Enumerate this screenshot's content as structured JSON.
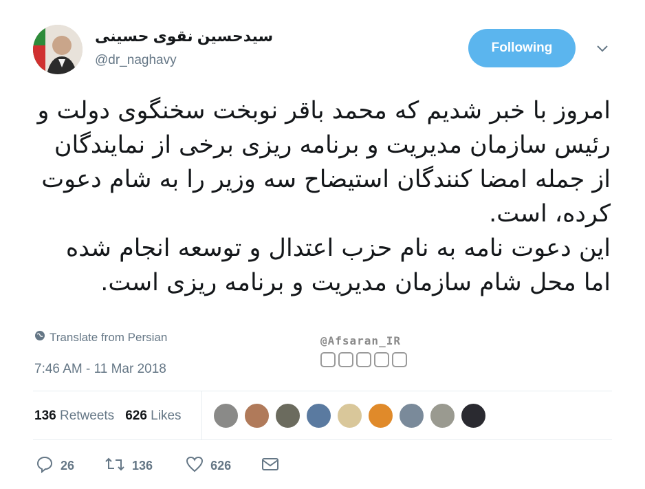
{
  "author": {
    "name": "سیدحسین نقوی حسینی",
    "handle": "@dr_naghavy"
  },
  "follow_button": {
    "label": "Following"
  },
  "tweet": {
    "paragraphs": [
      "امروز با خبر شدیم که محمد باقر نوبخت سخنگوی دولت و رئیس سازمان مدیریت و برنامه ریزی برخی از نمایندگان از جمله امضا کنندگان استیضاح سه وزیر را به شام دعوت کرده،  است.",
      "این دعوت نامه به نام حزب اعتدال و توسعه انجام شده اما محل شام سازمان مدیریت و برنامه ریزی است."
    ]
  },
  "translate_label": "Translate from Persian",
  "watermark": "@Afsaran_IR",
  "timestamp": "7:46 AM - 11 Mar 2018",
  "stats": {
    "retweets_count": "136",
    "retweets_label": "Retweets",
    "likes_count": "626",
    "likes_label": "Likes"
  },
  "actions": {
    "reply_count": "26",
    "retweet_count": "136",
    "like_count": "626"
  },
  "liker_colors": [
    "#8a8a88",
    "#b07a5a",
    "#6b6b5e",
    "#5a7aa0",
    "#d9c79a",
    "#e08a2a",
    "#7a8a9a",
    "#9a9a90",
    "#2a2a30"
  ],
  "colors": {
    "accent": "#5bb5ee",
    "muted": "#657786"
  }
}
